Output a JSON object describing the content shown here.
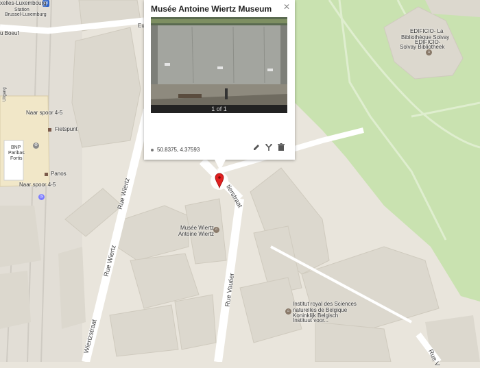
{
  "map": {
    "labels": {
      "station_1": "xelles-Luxembourg",
      "station_2": "Station",
      "station_3": "Brussel-Luxemburg",
      "boeuf": "u Boeuf",
      "eu": "Eu",
      "naar_spoor_top": "Naar spoor 4-5",
      "fietspunt": "Fietspunt",
      "panos": "Panos",
      "naar_spoor_bottom": "Naar spoor 4-5",
      "bnp_1": "BNP",
      "bnp_2": "Paribas",
      "bnp_3": "Fortis",
      "left_tag": "Uitgang",
      "museum_1": "Musée Wiertz",
      "museum_2": "Antoine Wiertz",
      "solvay_1": "EDIFICIO- La",
      "solvay_2": "Bibliothèque Solvay",
      "solvay_3": "EDIFICIO-",
      "solvay_4": "Solvay Bibliotheek",
      "institut_1": "Institut royal des Sciences",
      "institut_2": "naturelles de Belgique",
      "institut_3": "Koninklijk Belgisch",
      "institut_4": "Instituut voor..."
    },
    "streets": {
      "rue_wiertz": "Rue Wiertz",
      "wiertzstraat": "Wiertzstraat",
      "rue_vautier": "Rue Vautier",
      "tierstraat": "tierstraat",
      "rue_partial": "Rue V"
    },
    "colors": {
      "background": "#e9e5dc",
      "park": "#c9e2b0",
      "road": "#ffffff",
      "building": "#dcd8ce",
      "marker": "#e02020"
    }
  },
  "popup": {
    "title": "Musée Antoine Wiertz Museum",
    "photo_counter": "1 of 1",
    "coordinates": "50.8375, 4.37593",
    "close_icon": "close-icon",
    "tools": [
      "edit-icon",
      "directions-icon",
      "delete-icon"
    ]
  }
}
